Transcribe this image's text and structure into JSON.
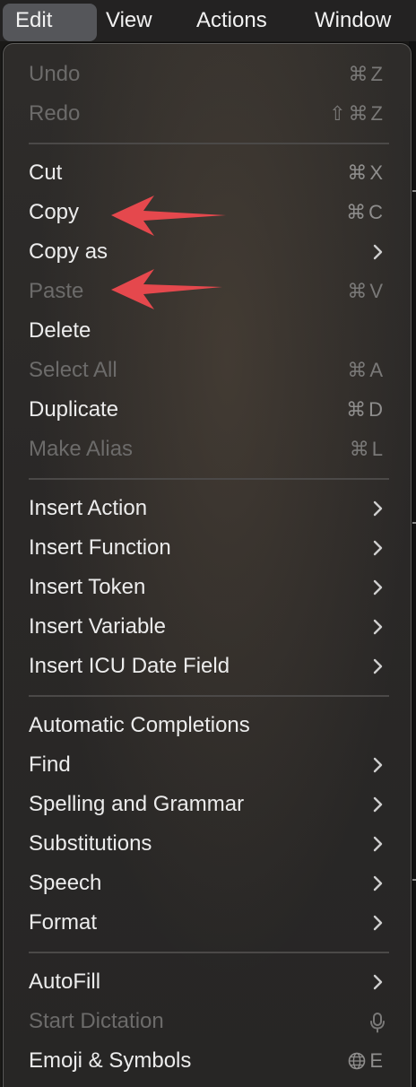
{
  "menubar": {
    "items": [
      {
        "label": "Edit",
        "active": true
      },
      {
        "label": "View"
      },
      {
        "label": "Actions"
      },
      {
        "label": "Window"
      }
    ]
  },
  "menu": {
    "sections": [
      {
        "items": [
          {
            "label": "Undo",
            "shortcut": "⌘Z",
            "enabled": false
          },
          {
            "label": "Redo",
            "shortcut": "⇧⌘Z",
            "enabled": false
          }
        ]
      },
      {
        "items": [
          {
            "label": "Cut",
            "shortcut": "⌘X",
            "enabled": true
          },
          {
            "label": "Copy",
            "shortcut": "⌘C",
            "enabled": true
          },
          {
            "label": "Copy as",
            "submenu": true,
            "enabled": true
          },
          {
            "label": "Paste",
            "shortcut": "⌘V",
            "enabled": false
          },
          {
            "label": "Delete",
            "enabled": true
          },
          {
            "label": "Select All",
            "shortcut": "⌘A",
            "enabled": false
          },
          {
            "label": "Duplicate",
            "shortcut": "⌘D",
            "enabled": true
          },
          {
            "label": "Make Alias",
            "shortcut": "⌘L",
            "enabled": false
          }
        ]
      },
      {
        "items": [
          {
            "label": "Insert Action",
            "submenu": true,
            "enabled": true
          },
          {
            "label": "Insert Function",
            "submenu": true,
            "enabled": true
          },
          {
            "label": "Insert Token",
            "submenu": true,
            "enabled": true
          },
          {
            "label": "Insert Variable",
            "submenu": true,
            "enabled": true
          },
          {
            "label": "Insert ICU Date Field",
            "submenu": true,
            "enabled": true
          }
        ]
      },
      {
        "items": [
          {
            "label": "Automatic Completions",
            "enabled": true
          },
          {
            "label": "Find",
            "submenu": true,
            "enabled": true
          },
          {
            "label": "Spelling and Grammar",
            "submenu": true,
            "enabled": true
          },
          {
            "label": "Substitutions",
            "submenu": true,
            "enabled": true
          },
          {
            "label": "Speech",
            "submenu": true,
            "enabled": true
          },
          {
            "label": "Format",
            "submenu": true,
            "enabled": true
          }
        ]
      },
      {
        "items": [
          {
            "label": "AutoFill",
            "submenu": true,
            "enabled": true
          },
          {
            "label": "Start Dictation",
            "icon": "microphone-icon",
            "enabled": false
          },
          {
            "label": "Emoji & Symbols",
            "icon": "globe-icon",
            "shortcut": "E",
            "enabled": true
          }
        ]
      }
    ]
  },
  "annotations": [
    {
      "target": "Copy",
      "icon": "red-arrow-icon",
      "color": "#e5484d"
    },
    {
      "target": "Paste",
      "icon": "red-arrow-icon",
      "color": "#e5484d"
    }
  ]
}
